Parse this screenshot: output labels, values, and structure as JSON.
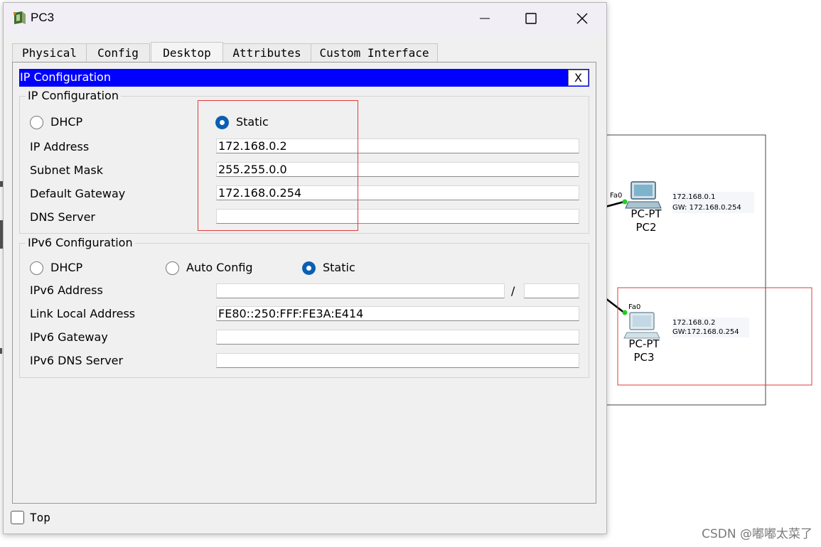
{
  "window": {
    "title": "PC3"
  },
  "tabs": [
    {
      "label": "Physical"
    },
    {
      "label": "Config"
    },
    {
      "label": "Desktop",
      "active": true
    },
    {
      "label": "Attributes"
    },
    {
      "label": "Custom Interface"
    }
  ],
  "ip_panel": {
    "title": "IP Configuration",
    "close_label": "X",
    "ipv4": {
      "title": "IP Configuration",
      "mode_options": [
        {
          "label": "DHCP",
          "checked": false
        },
        {
          "label": "Static",
          "checked": true
        }
      ],
      "fields": [
        {
          "label": "IP Address",
          "value": "172.168.0.2"
        },
        {
          "label": "Subnet Mask",
          "value": "255.255.0.0"
        },
        {
          "label": "Default Gateway",
          "value": "172.168.0.254"
        },
        {
          "label": "DNS Server",
          "value": ""
        }
      ]
    },
    "ipv6": {
      "title": "IPv6 Configuration",
      "mode_options": [
        {
          "label": "DHCP",
          "checked": false
        },
        {
          "label": "Auto Config",
          "checked": false
        },
        {
          "label": "Static",
          "checked": true
        }
      ],
      "address_label": "IPv6 Address",
      "address_value": "",
      "prefix_separator": "/",
      "prefix_value": "",
      "link_local_label": "Link Local Address",
      "link_local_value": "FE80::250:FFF:FE3A:E414",
      "gateway_label": "IPv6 Gateway",
      "gateway_value": "",
      "dns_label": "IPv6 DNS Server",
      "dns_value": ""
    }
  },
  "footer": {
    "top_label": "Top",
    "top_checked": false
  },
  "topology": {
    "pc2": {
      "port": "Fa0",
      "type": "PC-PT",
      "name": "PC2",
      "ip": "172.168.0.1",
      "gw": "GW:  172.168.0.254"
    },
    "pc3": {
      "port": "Fa0",
      "type": "PC-PT",
      "name": "PC3",
      "ip": "172.168.0.2",
      "gw": "GW:172.168.0.254"
    }
  },
  "watermark": "CSDN @嘟嘟太菜了",
  "colors": {
    "panel_header": "#0000ff",
    "radio_checked": "#0a5fb4",
    "highlight_box": "#e03b3b",
    "link_light": "#22cc22"
  }
}
